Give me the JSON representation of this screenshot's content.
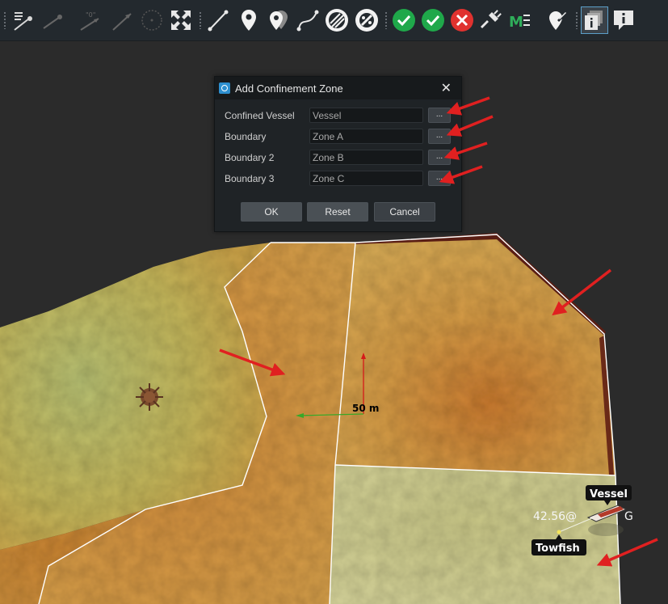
{
  "toolbar": {
    "tools": [
      {
        "name": "tool-select",
        "icon": "select-list-icon"
      },
      {
        "name": "tool-dropdown-pointer",
        "icon": "pointer-line-icon"
      },
      {
        "name": "tool-measure",
        "icon": "dimension-line-icon"
      },
      {
        "name": "tool-angle",
        "icon": "arrow-line-icon"
      },
      {
        "name": "tool-circle",
        "icon": "dotted-circle-icon"
      },
      {
        "name": "tool-fit-extent",
        "icon": "expand-icon"
      },
      {
        "name": "tool-draw-line",
        "icon": "line-segment-icon"
      },
      {
        "name": "tool-place-marker",
        "icon": "map-pin-icon"
      },
      {
        "name": "tool-place-multiple",
        "icon": "multi-pin-icon"
      },
      {
        "name": "tool-draw-curve",
        "icon": "curve-icon"
      },
      {
        "name": "tool-hatch-zone",
        "icon": "hatched-circle-icon"
      },
      {
        "name": "tool-no-go",
        "icon": "prohibited-zone-icon"
      },
      {
        "name": "tool-accept",
        "icon": "check-icon"
      },
      {
        "name": "tool-accept-all",
        "icon": "check-circle-icon"
      },
      {
        "name": "tool-reject",
        "icon": "x-circle-icon"
      },
      {
        "name": "tool-connect",
        "icon": "plug-icon"
      },
      {
        "name": "tool-mark-e",
        "icon": "me-icon"
      },
      {
        "name": "tool-pin-edit",
        "icon": "pin-edit-icon"
      },
      {
        "name": "tool-layers-info",
        "icon": "layered-info-icon"
      },
      {
        "name": "tool-info",
        "icon": "info-comment-icon"
      }
    ]
  },
  "dialog": {
    "title": "Add Confinement Zone",
    "close_label": "✕",
    "rows": [
      {
        "label": "Confined Vessel",
        "value": "Vessel",
        "browse": "..."
      },
      {
        "label": "Boundary",
        "value": "Zone A",
        "browse": "..."
      },
      {
        "label": "Boundary 2",
        "value": "Zone B",
        "browse": "..."
      },
      {
        "label": "Boundary 3",
        "value": "Zone C",
        "browse": "..."
      }
    ],
    "buttons": {
      "ok": "OK",
      "reset": "Reset",
      "cancel": "Cancel"
    }
  },
  "scene": {
    "scale_label": "50 m",
    "vessel_label": "Vessel",
    "towfish_label": "Towfish",
    "readout": "42.56@",
    "readout_tail": "G",
    "colors": {
      "annotation_arrow": "#e02020",
      "accept_green": "#1fa84a",
      "reject_red": "#e0322f"
    }
  }
}
